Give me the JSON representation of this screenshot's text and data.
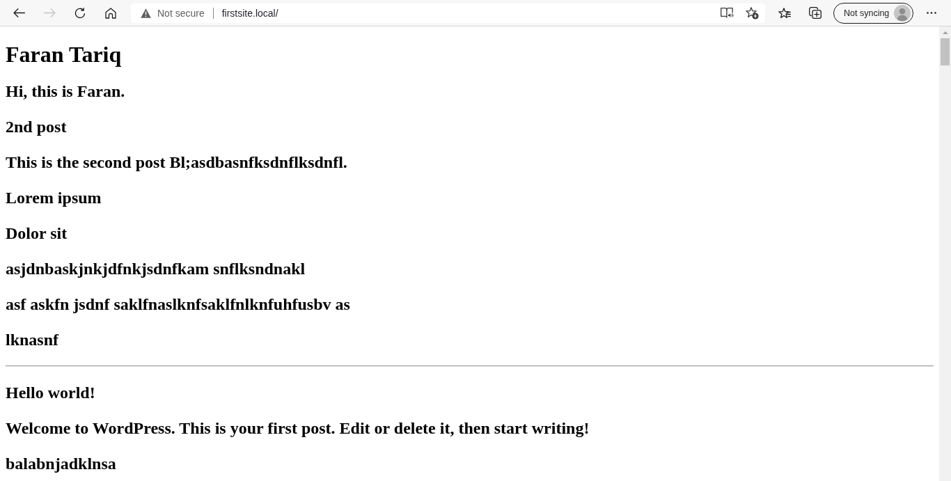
{
  "browser": {
    "nav_buttons": [
      {
        "kind": "back",
        "disabled": false
      },
      {
        "kind": "forward",
        "disabled": true
      },
      {
        "kind": "reload",
        "disabled": false
      },
      {
        "kind": "home",
        "disabled": false
      }
    ],
    "address_bar": {
      "security_label": "Not secure",
      "url": "firstsite.local/",
      "buttons": [
        {
          "kind": "read_aloud"
        },
        {
          "kind": "add_favorite"
        }
      ]
    },
    "toolbar_buttons": [
      {
        "kind": "favorites"
      },
      {
        "kind": "collections"
      },
      {
        "kind": "profile",
        "label": "Not syncing"
      },
      {
        "kind": "more"
      }
    ]
  },
  "page": {
    "site_title": "Faran Tariq",
    "tagline": "Hi, this is Faran.",
    "posts": [
      {
        "title": "2nd post",
        "lines": [
          "This is the second post Bl;asdbasnfksdnflksdnfl.",
          "Lorem ipsum",
          "Dolor sit",
          "asjdnbaskjnkjdfnkjsdnfkam snflksndnakl",
          "asf askfn jsdnf saklfnaslknfsaklfnlknfuhfusbv as",
          "lknasnf"
        ]
      },
      {
        "title": "Hello world!",
        "lines": [
          "Welcome to WordPress. This is your first post. Edit or delete it, then start writing!",
          "balabnjadklnsa"
        ]
      }
    ]
  }
}
